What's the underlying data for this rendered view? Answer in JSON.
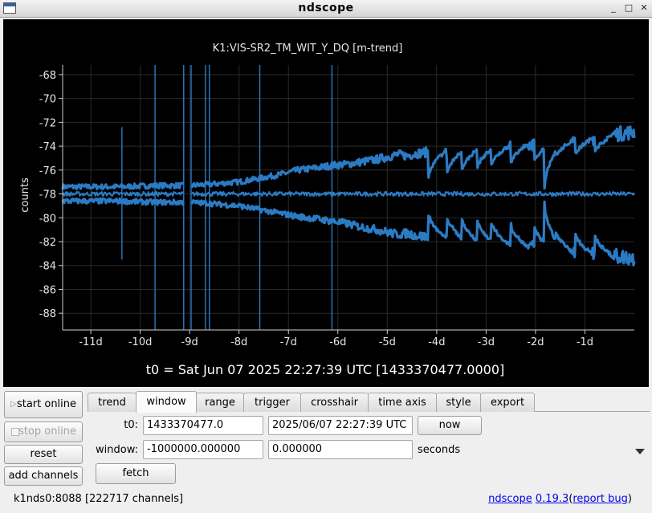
{
  "window": {
    "title": "ndscope",
    "icon": "window-menu-icon",
    "controls": {
      "minimize": "_",
      "maximize": "□",
      "close": "✕"
    }
  },
  "chart_data": {
    "type": "line",
    "title": "K1:VIS-SR2_TM_WIT_Y_DQ [m-trend]",
    "xlabel": "t0 = Sat Jun 07 2025 22:27:39 UTC [1433370477.0000]",
    "ylabel": "counts",
    "x_unit": "days relative to t0",
    "xlim": [
      -11.57,
      0
    ],
    "ylim": [
      -89.4,
      -67.2
    ],
    "x_ticks": [
      -11,
      -10,
      -9,
      -8,
      -7,
      -6,
      -5,
      -4,
      -3,
      -2,
      -1
    ],
    "x_tick_labels": [
      "-11d",
      "-10d",
      "-9d",
      "-8d",
      "-7d",
      "-6d",
      "-5d",
      "-4d",
      "-3d",
      "-2d",
      "-1d"
    ],
    "y_ticks": [
      -68,
      -70,
      -72,
      -74,
      -76,
      -78,
      -80,
      -82,
      -84,
      -86,
      -88
    ],
    "y_tick_labels": [
      "-68",
      "-70",
      "-72",
      "-74",
      "-76",
      "-78",
      "-80",
      "-82",
      "-84",
      "-86",
      "-88"
    ],
    "grid": true,
    "color": "#2b7bc4",
    "background": "#000000",
    "series": [
      {
        "stat": "max",
        "x": [
          -11.57,
          -10.4,
          -9.7,
          -9.0,
          -8.6,
          -8.0,
          -7.6,
          -7.2,
          -6.8,
          -6.4,
          -6.1,
          -5.8,
          -5.5,
          -5.2,
          -5.0,
          -4.8,
          -4.6,
          -4.4,
          -4.2,
          -4.0,
          -3.8,
          -3.6,
          -3.4,
          -3.2,
          -3.0,
          -2.8,
          -2.6,
          -2.4,
          -2.2,
          -2.0,
          -1.8,
          -1.6,
          -1.4,
          -1.2,
          -1.0,
          -0.8,
          -0.6,
          -0.4,
          -0.2,
          0
        ],
        "y": [
          -77.4,
          -77.4,
          -77.3,
          -77.3,
          -77.2,
          -77.0,
          -76.7,
          -76.4,
          -76.0,
          -75.8,
          -75.6,
          -75.5,
          -75.3,
          -75.1,
          -74.9,
          -74.7,
          -74.8,
          -74.6,
          -74.5,
          -74.4,
          -74.5,
          -74.3,
          -74.3,
          -74.2,
          -74.1,
          -74.2,
          -74.0,
          -73.9,
          -73.8,
          -73.9,
          -73.7,
          -73.6,
          -73.6,
          -73.5,
          -73.4,
          -73.3,
          -73.2,
          -73.0,
          -72.9,
          -72.8
        ],
        "dips": [
          [
            -4.18,
            -77.0
          ],
          [
            -3.8,
            -76.6
          ],
          [
            -3.5,
            -76.3
          ],
          [
            -3.18,
            -76.0
          ],
          [
            -2.9,
            -75.8
          ],
          [
            -2.5,
            -75.6
          ],
          [
            -2.02,
            -75.4
          ],
          [
            -1.82,
            -77.8
          ],
          [
            -1.6,
            -75.1
          ],
          [
            -1.2,
            -74.9
          ],
          [
            -0.8,
            -74.6
          ]
        ]
      },
      {
        "stat": "mean",
        "x": [
          -11.57,
          0
        ],
        "y": [
          -78.0,
          -78.0
        ]
      },
      {
        "stat": "min",
        "x": [
          -11.57,
          -10.4,
          -9.7,
          -9.0,
          -8.6,
          -8.0,
          -7.6,
          -7.2,
          -6.8,
          -6.4,
          -6.1,
          -5.8,
          -5.5,
          -5.2,
          -5.0,
          -4.8,
          -4.6,
          -4.4,
          -4.2,
          -4.0,
          -3.8,
          -3.6,
          -3.4,
          -3.2,
          -3.0,
          -2.8,
          -2.6,
          -2.4,
          -2.2,
          -2.0,
          -1.8,
          -1.6,
          -1.4,
          -1.2,
          -1.0,
          -0.8,
          -0.6,
          -0.4,
          -0.2,
          0
        ],
        "y": [
          -78.6,
          -78.6,
          -78.7,
          -78.7,
          -78.8,
          -79.0,
          -79.3,
          -79.6,
          -79.9,
          -80.1,
          -80.3,
          -80.5,
          -80.8,
          -81.0,
          -81.2,
          -81.4,
          -81.3,
          -81.5,
          -81.6,
          -81.7,
          -81.6,
          -81.8,
          -81.9,
          -82.0,
          -82.1,
          -82.0,
          -82.2,
          -82.3,
          -82.5,
          -82.4,
          -82.6,
          -82.7,
          -82.8,
          -82.9,
          -83.0,
          -83.0,
          -83.1,
          -83.2,
          -83.3,
          -83.4
        ],
        "dips": [
          [
            -4.18,
            -79.2
          ],
          [
            -3.8,
            -79.6
          ],
          [
            -3.5,
            -79.8
          ],
          [
            -3.18,
            -80.0
          ],
          [
            -2.9,
            -80.2
          ],
          [
            -2.5,
            -80.4
          ],
          [
            -2.02,
            -80.6
          ],
          [
            -1.82,
            -78.5
          ],
          [
            -1.6,
            -80.9
          ],
          [
            -1.2,
            -81.1
          ],
          [
            -0.8,
            -81.3
          ]
        ]
      }
    ],
    "spikes": [
      {
        "x": -10.37,
        "y": [
          -83.5,
          -72.4
        ]
      },
      {
        "x": -9.7,
        "y": [
          -89.4,
          -67.2
        ]
      },
      {
        "x": -9.12,
        "y": [
          -89.4,
          -67.2
        ]
      },
      {
        "x": -8.97,
        "y": [
          -89.4,
          -67.2
        ]
      },
      {
        "x": -8.68,
        "y": [
          -89.4,
          -67.2
        ]
      },
      {
        "x": -8.6,
        "y": [
          -89.4,
          -67.2
        ]
      },
      {
        "x": -7.58,
        "y": [
          -89.4,
          -67.2
        ]
      },
      {
        "x": -6.12,
        "y": [
          -89.4,
          -67.2
        ]
      }
    ],
    "gap": {
      "x_start": -9.12,
      "x_end": -8.97
    }
  },
  "controls": {
    "start_online": "start online",
    "start_glyph": "▷",
    "stop_online": "stop online",
    "reset": "reset",
    "add_channels": "add channels"
  },
  "tabs": [
    "trend",
    "window",
    "range",
    "trigger",
    "crosshair",
    "time axis",
    "style",
    "export"
  ],
  "active_tab": "window",
  "window_tab": {
    "t0_label": "t0:",
    "t0_gps": "1433370477.0",
    "t0_utc": "2025/06/07 22:27:39 UTC",
    "now_button": "now",
    "window_label": "window:",
    "window_start": "-1000000.000000",
    "window_end": "0.000000",
    "units": "seconds",
    "fetch_button": "fetch"
  },
  "status": {
    "server": "k1nds0:8088",
    "channels": "[222717 channels]",
    "app_name": "ndscope",
    "version": "0.19.3",
    "paren_open": "(",
    "report_bug": "report bug",
    "paren_close": ")"
  }
}
